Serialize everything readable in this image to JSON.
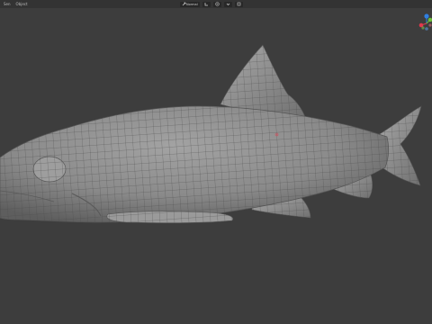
{
  "header": {
    "menu": [
      "Sen",
      "Object"
    ],
    "shading_mode": "Normal"
  },
  "gizmo": {
    "axes": [
      {
        "name": "z",
        "color": "#2f7fe0"
      },
      {
        "name": "y",
        "color": "#6cbd3a"
      },
      {
        "name": "x",
        "color": "#e0394d"
      }
    ]
  },
  "colors": {
    "viewport_bg": "#3d3d3d",
    "header_bg": "#333333",
    "mesh_fill": "#8c8c8c",
    "mesh_wire": "#4a4a4a"
  }
}
